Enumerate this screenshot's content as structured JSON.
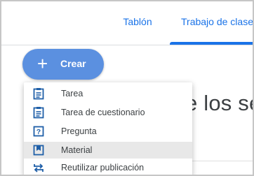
{
  "tabs": {
    "tablon": "Tablón",
    "trabajo": "Trabajo de clase"
  },
  "create_button": {
    "plus": "+",
    "label": "Crear"
  },
  "background": {
    "heading": "e los se"
  },
  "menu": {
    "items": [
      {
        "label": "Tarea",
        "icon": "assignment-icon"
      },
      {
        "label": "Tarea de cuestionario",
        "icon": "quiz-assignment-icon"
      },
      {
        "label": "Pregunta",
        "icon": "question-icon"
      },
      {
        "label": "Material",
        "icon": "material-icon",
        "selected": true
      },
      {
        "label": "Reutilizar publicación",
        "icon": "reuse-icon"
      }
    ]
  },
  "colors": {
    "accent": "#1a73e8",
    "create_button": "#5b90e0",
    "icon": "#1f5fa8",
    "selected_item": "#e8e8e8"
  }
}
